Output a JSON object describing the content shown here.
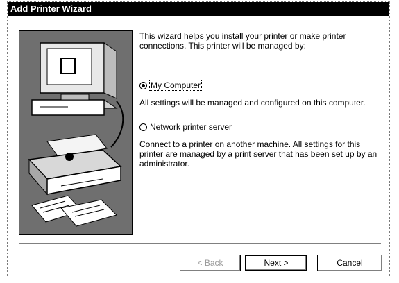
{
  "window": {
    "title": "Add Printer Wizard"
  },
  "intro_text": "This wizard helps you install your printer or make printer connections.  This printer will be managed by:",
  "options": [
    {
      "label": "My Computer",
      "checked": true,
      "description": "All settings will be managed and configured on this computer."
    },
    {
      "label": "Network printer server",
      "checked": false,
      "description": "Connect to a printer on another machine.  All settings for this printer are managed by a print server that has been set up by an administrator."
    }
  ],
  "buttons": {
    "back": "< Back",
    "next": "Next >",
    "cancel": "Cancel"
  },
  "illustration": {
    "icons": [
      "computer-icon",
      "printer-icon",
      "paper-documents-icon"
    ]
  }
}
